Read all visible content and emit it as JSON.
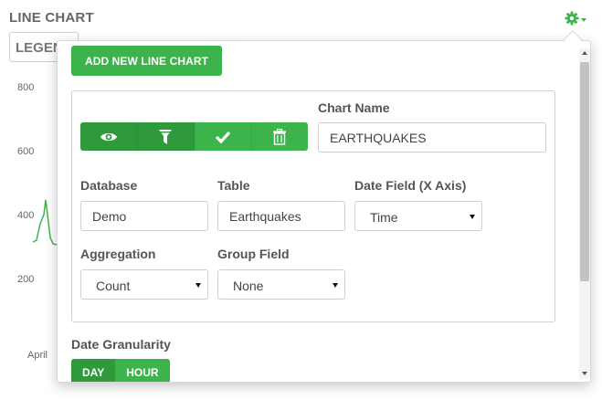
{
  "widget": {
    "title": "LINE CHART",
    "legend_label": "LEGEND",
    "y_ticks": [
      "800",
      "600",
      "400",
      "200"
    ],
    "x_tick": "April",
    "settings_icon": "gear-icon"
  },
  "popover": {
    "add_button": "ADD NEW LINE CHART",
    "toolbar_icons": [
      "eye-icon",
      "filter-icon",
      "check-icon",
      "trash-icon"
    ],
    "chart_name": {
      "label": "Chart Name",
      "value": "EARTHQUAKES"
    },
    "database": {
      "label": "Database",
      "value": "Demo"
    },
    "table": {
      "label": "Table",
      "value": "Earthquakes"
    },
    "date_field": {
      "label": "Date Field (X Axis)",
      "value": "Time"
    },
    "aggregation": {
      "label": "Aggregation",
      "value": "Count"
    },
    "group_field": {
      "label": "Group Field",
      "value": "None"
    },
    "granularity": {
      "label": "Date Granularity",
      "options": [
        "DAY",
        "HOUR"
      ],
      "selected": "DAY"
    }
  },
  "colors": {
    "accent": "#3cb44b",
    "accent_dark": "#2e9a3c"
  }
}
